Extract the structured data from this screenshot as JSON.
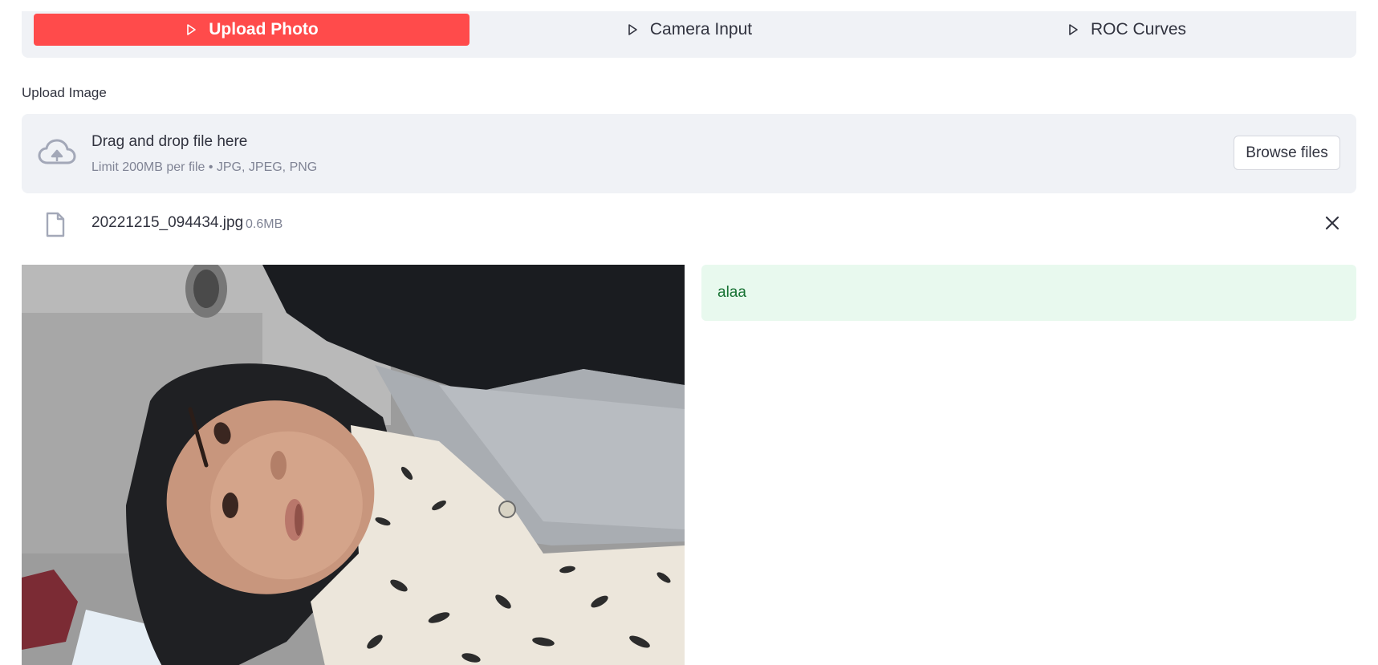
{
  "tabs": [
    {
      "label": "Upload Photo",
      "active": true
    },
    {
      "label": "Camera Input",
      "active": false
    },
    {
      "label": "ROC Curves",
      "active": false
    }
  ],
  "uploader": {
    "label": "Upload Image",
    "drop_title": "Drag and drop file here",
    "drop_subtitle": "Limit 200MB per file • JPG, JPEG, PNG",
    "browse_label": "Browse files",
    "icon": "cloud-upload-icon"
  },
  "file": {
    "name": "20221215_094434.jpg",
    "size": "0.6MB",
    "icon": "file-icon"
  },
  "result": {
    "text": "alaa"
  },
  "colors": {
    "accent": "#ff4b4b",
    "panel_bg": "#f0f2f6",
    "success_bg": "#e8f9ee",
    "success_text": "#177233"
  }
}
